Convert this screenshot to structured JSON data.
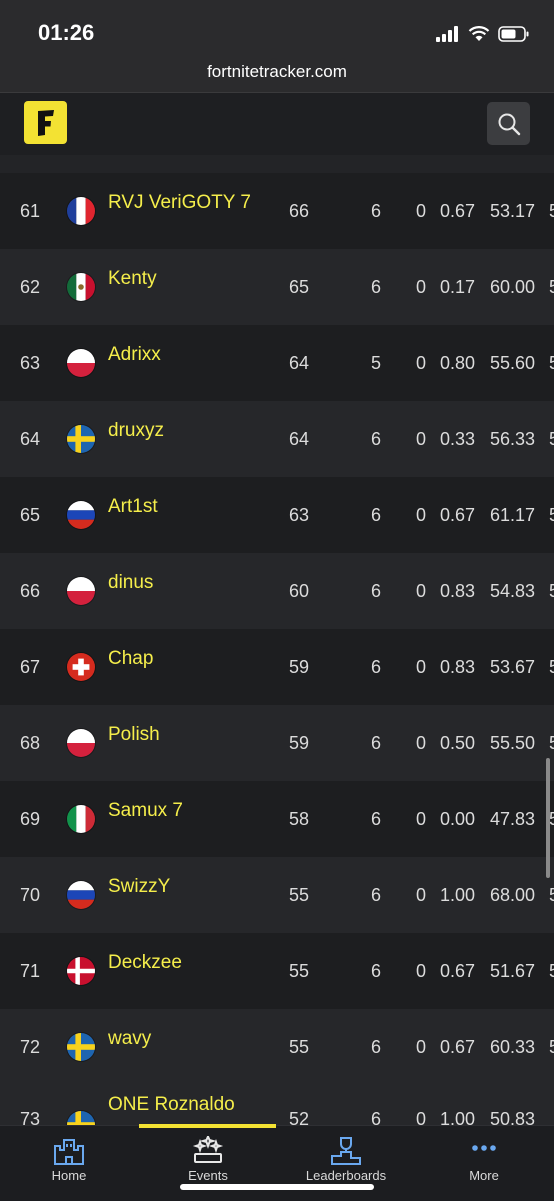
{
  "status_bar": {
    "time": "01:26"
  },
  "browser": {
    "url": "fortnitetracker.com"
  },
  "header": {
    "logo_letter": "F"
  },
  "rows": [
    {
      "rank": "61",
      "country": "france",
      "name": "RVJ VeriGOTY 7",
      "points": "66",
      "c5": "6",
      "c6": "0",
      "c7": "0.67",
      "c8": "53.17",
      "c9": "5"
    },
    {
      "rank": "62",
      "country": "mexico",
      "name": "Kenty",
      "points": "65",
      "c5": "6",
      "c6": "0",
      "c7": "0.17",
      "c8": "60.00",
      "c9": "5"
    },
    {
      "rank": "63",
      "country": "poland",
      "name": "Adrixx",
      "points": "64",
      "c5": "5",
      "c6": "0",
      "c7": "0.80",
      "c8": "55.60",
      "c9": "5"
    },
    {
      "rank": "64",
      "country": "sweden",
      "name": "druxyz",
      "points": "64",
      "c5": "6",
      "c6": "0",
      "c7": "0.33",
      "c8": "56.33",
      "c9": "5"
    },
    {
      "rank": "65",
      "country": "russia",
      "name": "Art1st",
      "points": "63",
      "c5": "6",
      "c6": "0",
      "c7": "0.67",
      "c8": "61.17",
      "c9": "5"
    },
    {
      "rank": "66",
      "country": "poland",
      "name": "dinus",
      "points": "60",
      "c5": "6",
      "c6": "0",
      "c7": "0.83",
      "c8": "54.83",
      "c9": "5"
    },
    {
      "rank": "67",
      "country": "switzerland",
      "name": "Chap",
      "points": "59",
      "c5": "6",
      "c6": "0",
      "c7": "0.83",
      "c8": "53.67",
      "c9": "5"
    },
    {
      "rank": "68",
      "country": "poland",
      "name": "Polish",
      "points": "59",
      "c5": "6",
      "c6": "0",
      "c7": "0.50",
      "c8": "55.50",
      "c9": "5"
    },
    {
      "rank": "69",
      "country": "italy",
      "name": "Samux 7",
      "points": "58",
      "c5": "6",
      "c6": "0",
      "c7": "0.00",
      "c8": "47.83",
      "c9": "5"
    },
    {
      "rank": "70",
      "country": "russia",
      "name": "SwizzY",
      "points": "55",
      "c5": "6",
      "c6": "0",
      "c7": "1.00",
      "c8": "68.00",
      "c9": "5"
    },
    {
      "rank": "71",
      "country": "denmark",
      "name": "Deckzee",
      "points": "55",
      "c5": "6",
      "c6": "0",
      "c7": "0.67",
      "c8": "51.67",
      "c9": "5"
    },
    {
      "rank": "72",
      "country": "sweden",
      "name": "wavy",
      "points": "55",
      "c5": "6",
      "c6": "0",
      "c7": "0.67",
      "c8": "60.33",
      "c9": "5"
    }
  ],
  "partial_row": {
    "rank": "73",
    "country": "sweden",
    "name": "ONE Roznaldo",
    "points": "52",
    "c5": "6",
    "c6": "0",
    "c7": "1.00",
    "c8": "50.83"
  },
  "bottom_nav": {
    "items": [
      {
        "label": "Home",
        "icon": "castle-icon"
      },
      {
        "label": "Events",
        "icon": "podium-stars-icon"
      },
      {
        "label": "Leaderboards",
        "icon": "trophy-podium-icon"
      },
      {
        "label": "More",
        "icon": "more-dots-icon"
      }
    ],
    "active": "Events"
  },
  "colors": {
    "accent": "#f3e233",
    "player_name": "#f5ee4b",
    "nav_icon": "#6aa8ef"
  }
}
